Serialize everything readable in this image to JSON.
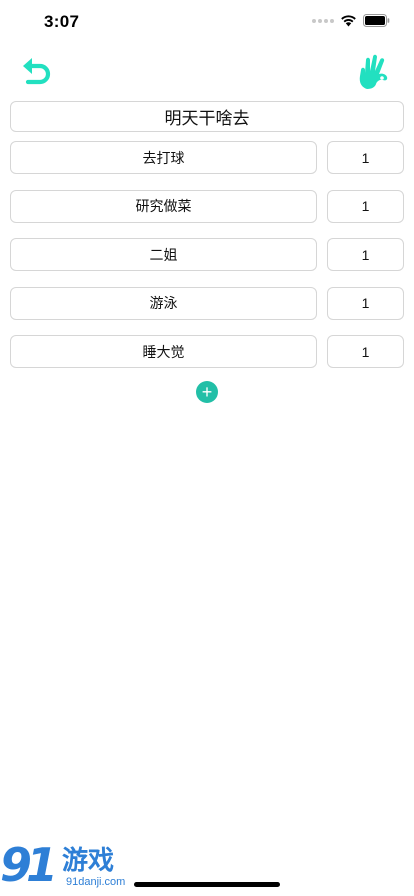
{
  "status": {
    "time": "3:07"
  },
  "colors": {
    "accent": "#22e0c0",
    "add_button": "#22bfa7",
    "border": "#d6d6d6",
    "watermark": "#2e7fd6"
  },
  "toolbar": {
    "left_icon": "undo-arrow-icon",
    "right_icon": "ok-hand-icon"
  },
  "title": "明天干啥去",
  "options": [
    {
      "name": "去打球",
      "weight": "1"
    },
    {
      "name": "研究做菜",
      "weight": "1"
    },
    {
      "name": "二姐",
      "weight": "1"
    },
    {
      "name": "游泳",
      "weight": "1"
    },
    {
      "name": "睡大觉",
      "weight": "1"
    }
  ],
  "add_button": {
    "label": "+"
  },
  "watermark": {
    "logo": "91",
    "name": "游戏",
    "url": "91danji.com"
  }
}
